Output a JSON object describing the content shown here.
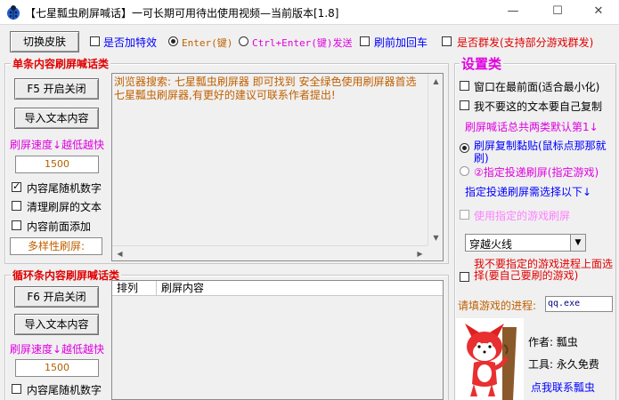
{
  "window": {
    "title": "【七星瓢虫刷屏喊话】一可长期可用待出使用视频—当前版本[1.8]",
    "icon": "ladybug-icon"
  },
  "toolbar": {
    "skin_button": "切换皮肤",
    "special_effect": "是否加特效",
    "enter_key": "Enter(键)",
    "ctrl_enter": "Ctrl+Enter(键)发送",
    "refresh_carriage": "刷前加回车",
    "group_send": "是否群发(支持部分游戏群发)"
  },
  "single": {
    "title": "单条内容刷屏喊话类",
    "f5_button": "F5 开启关闭",
    "import_button": "导入文本内容",
    "speed_label": "刷屏速度↓越低越快",
    "speed_value": "1500",
    "tail_random": "内容尾随机数字",
    "clear_text": "清理刷屏的文本",
    "prefix_add": "内容前面添加",
    "diversity_label": "多样性刷屏:",
    "text_content": "浏览器搜索: 七星瓢虫刷屏器 即可找到 安全绿色使用刷屏器首选\n七星瓢虫刷屏器,有更好的建议可联系作者提出!"
  },
  "loop": {
    "title": "循环条内容刷屏喊话类",
    "f6_button": "F6 开启关闭",
    "import_button": "导入文本内容",
    "speed_label": "刷屏速度↓越低越快",
    "speed_value": "1500",
    "tail_random": "内容尾随机数字",
    "col_order": "排列",
    "col_content": "刷屏内容"
  },
  "settings": {
    "title": "设置类",
    "topmost": "窗口在最前面(适合最小化)",
    "no_copy": "我不要这的文本要自己复制",
    "two_modes": "刷屏喊话总共两类默认第1↓",
    "mode1": "刷屏复制黏贴(鼠标点那那就刷)",
    "mode2": "②指定投递刷屏(指定游戏)",
    "mode2_hint": "指定投递刷屏需选择以下↓",
    "use_game": "使用指定的游戏刷屏",
    "game_selected": "穿越火线",
    "no_process": "我不要指定的游戏进程上面选择(要自己要刷的游戏)",
    "process_label": "请填游戏的进程:",
    "process_value": "qq.exe",
    "author": "作者: 瓢虫",
    "tool": "工具: 永久免费",
    "contact": "点我联系瓢虫"
  },
  "colors": {
    "red": "#e00000",
    "blue": "#0000ff",
    "magenta": "#e000e0",
    "brown": "#c06000"
  }
}
